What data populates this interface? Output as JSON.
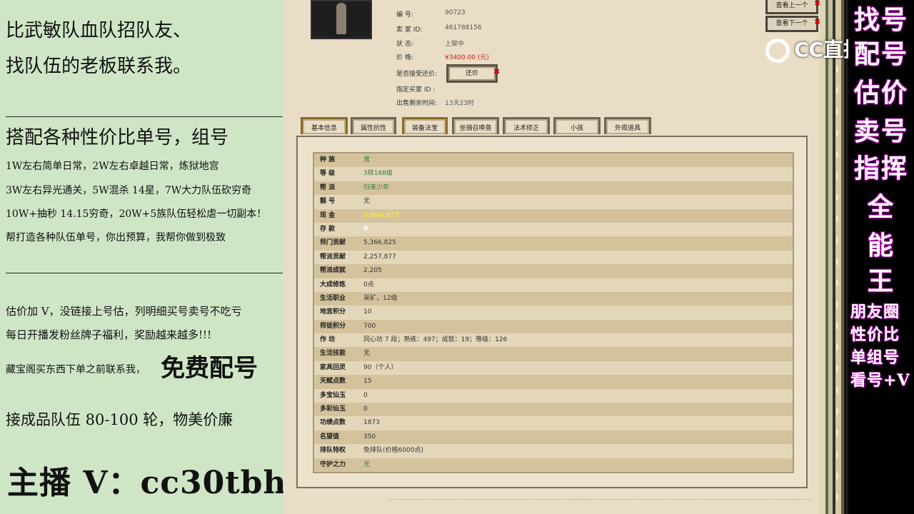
{
  "promo": {
    "line1": "比武敏队血队招队友、",
    "line2": "找队伍的老板联系我。",
    "line3": "搭配各种性价比单号，组号",
    "line4": "1W左右简单日常，2W左右卓越日常，炼狱地宫",
    "line5": "3W左右异光通关，5W混杀 14星，7W大力队伍砍穷奇",
    "line6": "10W+抽秒 14.15穷奇，20W+5族队伍轻松虐一切副本！",
    "line7": "帮打造各种队伍单号，你出预算，我帮你做到极致",
    "line8": "估价加 V，没链接上号估，列明细买号卖号不吃亏",
    "line9": "每日开播发粉丝牌子福利，奖励越来越多!!!",
    "line10": "藏宝阁买东西下单之前联系我，",
    "free_match": "免费配号",
    "line11": "接成品队伍 80-100 轮，物美价廉",
    "host": "主播 V：cc30tbh"
  },
  "listing": {
    "id_label": "编        号:",
    "id_value": "90723",
    "seller_label": "卖  家   ID:",
    "seller_value": "461788156",
    "status_label": "状        态:",
    "status_value": "上架中",
    "price_label": "价        格:",
    "price_value": "¥3400.00 (元)",
    "accept_label": "是否接受还价:",
    "bargain_button": "还价",
    "buyer_label": "指定买家 ID :",
    "buyer_value": "",
    "remain_label": "出售剩余时间:",
    "remain_value": "13天23时"
  },
  "nav": {
    "prev": "查看上一个",
    "next": "查看下一个"
  },
  "tabs": [
    "基本信息",
    "属性抗性",
    "装备法宝",
    "坐骑召唤兽",
    "法术修正",
    "小孩",
    "外观道具"
  ],
  "details": [
    {
      "k": "种    族",
      "v": "鬼",
      "c": "green"
    },
    {
      "k": "等    级",
      "v": "3转168级",
      "c": "green"
    },
    {
      "k": "帮    派",
      "v": "归来少年",
      "c": "green"
    },
    {
      "k": "靓    号",
      "v": "无",
      "c": ""
    },
    {
      "k": "现    金",
      "v": "4,904,977",
      "c": "yellow"
    },
    {
      "k": "存    款",
      "v": "0",
      "c": "white"
    },
    {
      "k": "师门贡献",
      "v": "5,366,825",
      "c": ""
    },
    {
      "k": "帮派贡献",
      "v": "2,257,877",
      "c": ""
    },
    {
      "k": "帮派成就",
      "v": "2,205",
      "c": ""
    },
    {
      "k": "大成修炼",
      "v": "0点",
      "c": ""
    },
    {
      "k": "生活职业",
      "v": "采矿，12级",
      "c": ""
    },
    {
      "k": "地宫积分",
      "v": "10",
      "c": ""
    },
    {
      "k": "师徒积分",
      "v": "700",
      "c": ""
    },
    {
      "k": "作    坊",
      "v": "同心坊 7 段；熟练：497；成就：19；等级：126",
      "c": ""
    },
    {
      "k": "生活技能",
      "v": "无",
      "c": ""
    },
    {
      "k": "家具回灵",
      "v": "90（个人）",
      "c": ""
    },
    {
      "k": "天赋点数",
      "v": "15",
      "c": ""
    },
    {
      "k": "多宝仙玉",
      "v": "0",
      "c": ""
    },
    {
      "k": "多彩仙玉",
      "v": "0",
      "c": ""
    },
    {
      "k": "功绩点数",
      "v": "1873",
      "c": ""
    },
    {
      "k": "名望值",
      "v": "350",
      "c": ""
    },
    {
      "k": "排队特权",
      "v": "免排队(价格6000点)",
      "c": ""
    },
    {
      "k": "守护之力",
      "v": "无",
      "c": "green"
    }
  ],
  "overlay": {
    "logo": "CC直播",
    "big": [
      "找号",
      "配号",
      "估价",
      "卖号",
      "指挥",
      "全",
      "能",
      "王"
    ],
    "small": [
      "朋友圈",
      "性价比",
      "单组号",
      "看号+V"
    ]
  }
}
